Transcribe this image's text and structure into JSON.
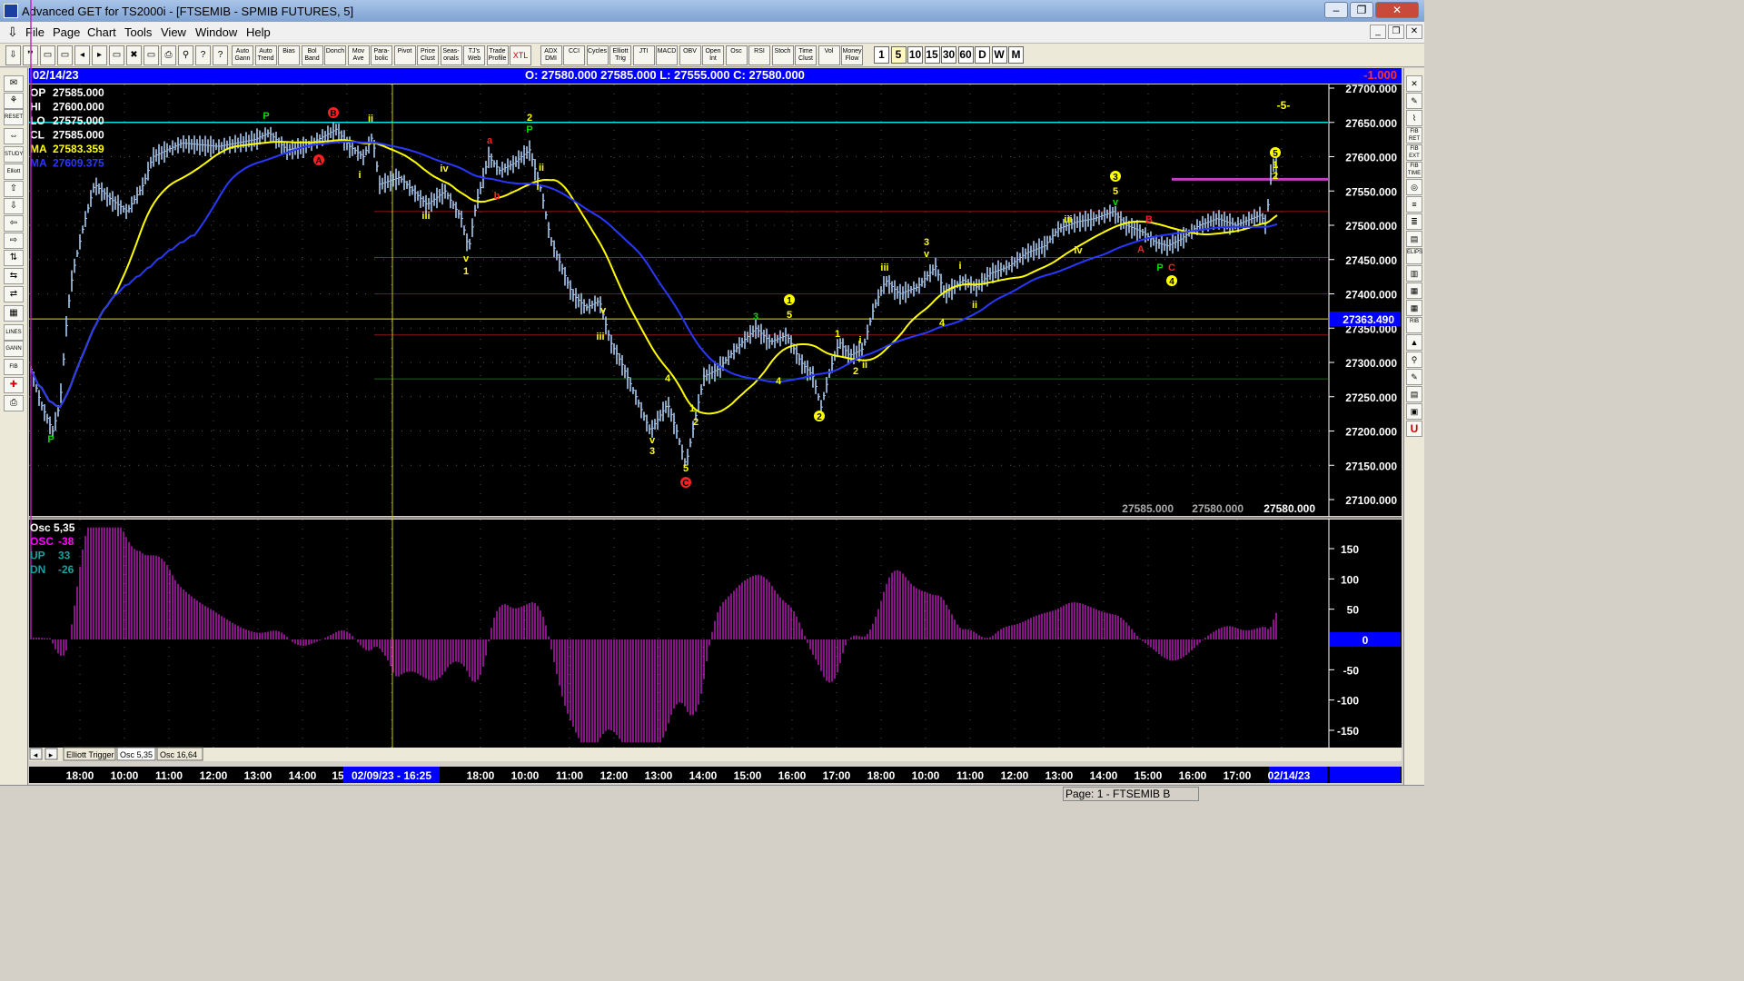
{
  "window": {
    "title": "Advanced GET for TS2000i - [FTSEMIB - SPMIB FUTURES, 5]",
    "controls": [
      "‒",
      "❐",
      "✕"
    ]
  },
  "menu": [
    "File",
    "Page",
    "Chart",
    "Tools",
    "View",
    "Window",
    "Help"
  ],
  "toolbar": {
    "study_buttons": [
      "Auto Gann",
      "Auto Trend",
      "Bias",
      "Bol Band",
      "Donch",
      "Mov Ave",
      "Para-bolic",
      "Pivot",
      "Price Clust",
      "Seas-onals",
      "TJ's Web",
      "Trade Profile",
      "XTL",
      "ADX DMI",
      "CCI",
      "Cycles",
      "Elliott Trig",
      "JTI",
      "MACD",
      "OBV",
      "Open Int",
      "Osc",
      "RSI",
      "Stoch",
      "Time Clust",
      "Vol",
      "Money Flow"
    ],
    "timeframes": [
      "1",
      "5",
      "10",
      "15",
      "30",
      "60",
      "D",
      "W",
      "M"
    ],
    "selected_timeframe": "5"
  },
  "left_tools": [
    "RESET",
    "STUDY",
    "Elliott",
    "LINES",
    "GANN",
    "FIB"
  ],
  "right_tools": [
    "FIB RET",
    "FIB EXT",
    "FIB TIME",
    "ELIPS",
    "RIB"
  ],
  "header": {
    "date": "02/14/23",
    "ohlc_text": "O: 27580.000     27585.000   L: 27555.000   C: 27580.000",
    "change": "-1.000"
  },
  "price_panel": {
    "info": [
      {
        "label": "OP",
        "value": "27585.000",
        "color": "#ffffff"
      },
      {
        "label": "HI",
        "value": "27600.000",
        "color": "#ffffff"
      },
      {
        "label": "LO",
        "value": "27575.000",
        "color": "#ffffff"
      },
      {
        "label": "CL",
        "value": "27585.000",
        "color": "#ffffff"
      },
      {
        "label": "MA",
        "value": "27583.359",
        "color": "#ffff00"
      },
      {
        "label": "MA",
        "value": "27609.375",
        "color": "#2a38ff"
      }
    ],
    "y_ticks": [
      "27700.000",
      "27650.000",
      "27600.000",
      "27550.000",
      "27500.000",
      "27450.000",
      "27400.000",
      "27350.000",
      "27300.000",
      "27250.000",
      "27200.000",
      "27150.000",
      "27100.000"
    ],
    "current_price_label": "27363.490",
    "bottom_values": [
      "27585.000",
      "27580.000",
      "27580.000"
    ],
    "wave_count_label": "-5-"
  },
  "osc_panel": {
    "title": "Osc 5,35",
    "rows": [
      {
        "label": "OSC",
        "value": "-38",
        "color": "#ff00ff"
      },
      {
        "label": "UP",
        "value": "33",
        "color": "#1aa0a0"
      },
      {
        "label": "DN",
        "value": "-26",
        "color": "#1aa0a0"
      }
    ],
    "y_ticks": [
      "150",
      "100",
      "50",
      "0",
      "-50",
      "-100",
      "-150"
    ],
    "zero_label": "0"
  },
  "tabs": [
    "Elliott Trigger",
    "Osc 5,35",
    "Osc 16,64"
  ],
  "time_axis": [
    "18:00",
    "10:00",
    "11:00",
    "12:00",
    "13:00",
    "14:00",
    "15",
    "18:00",
    "10:00",
    "11:00",
    "12:00",
    "13:00",
    "14:00",
    "15:00",
    "16:00",
    "17:00",
    "18:00",
    "10:00",
    "11:00",
    "12:00",
    "13:00",
    "14:00",
    "15:00",
    "16:00",
    "17:00",
    "02/14/23"
  ],
  "cursor_date": "02/09/23 - 16:25",
  "status": "Page: 1 - FTSEMIB B",
  "wave_labels": [
    {
      "t": "P",
      "color": "#00e000"
    },
    {
      "t": "P",
      "color": "#00e000"
    },
    {
      "t": "B",
      "color": "#ff2020"
    },
    {
      "t": "A",
      "color": "#ff2020"
    },
    {
      "t": "ii",
      "color": "#ffff00"
    },
    {
      "t": "i",
      "color": "#ffff00"
    },
    {
      "t": "iv",
      "color": "#ffff00"
    },
    {
      "t": "iii",
      "color": "#ffff00"
    },
    {
      "t": "v",
      "color": "#ffff00"
    },
    {
      "t": "1",
      "color": "#ffff00"
    },
    {
      "t": "a",
      "color": "#ff2020"
    },
    {
      "t": "b",
      "color": "#ff2020"
    },
    {
      "t": "2",
      "color": "#ffff00"
    },
    {
      "t": "P",
      "color": "#00e000"
    },
    {
      "t": "ii",
      "color": "#ffff00"
    },
    {
      "t": "i",
      "color": "#ffff00"
    },
    {
      "t": "v",
      "color": "#ffff00"
    },
    {
      "t": "iii",
      "color": "#ffff00"
    },
    {
      "t": "4",
      "color": "#ffff00"
    },
    {
      "t": "v",
      "color": "#ffff00"
    },
    {
      "t": "3",
      "color": "#ffff00"
    },
    {
      "t": "1",
      "color": "#ffff00"
    },
    {
      "t": "2",
      "color": "#ffff00"
    },
    {
      "t": "5",
      "color": "#ffff00"
    },
    {
      "t": "C",
      "color": "#ff2020"
    },
    {
      "t": "3",
      "color": "#00e000"
    },
    {
      "t": "4",
      "color": "#ffff00"
    },
    {
      "t": "1",
      "color": "#ffff00"
    },
    {
      "t": "5",
      "color": "#ffff00"
    },
    {
      "t": "2",
      "color": "#ffff00"
    },
    {
      "t": "1",
      "color": "#ffff00"
    },
    {
      "t": "2",
      "color": "#ffff00"
    },
    {
      "t": "i",
      "color": "#ffff00"
    },
    {
      "t": "ii",
      "color": "#ffff00"
    },
    {
      "t": "iii",
      "color": "#ffff00"
    },
    {
      "t": "3",
      "color": "#ffff00"
    },
    {
      "t": "v",
      "color": "#ffff00"
    },
    {
      "t": "4",
      "color": "#ffff00"
    },
    {
      "t": "i",
      "color": "#ffff00"
    },
    {
      "t": "ii",
      "color": "#ffff00"
    },
    {
      "t": "iii",
      "color": "#ffff00"
    },
    {
      "t": "iv",
      "color": "#ffff00"
    },
    {
      "t": "3",
      "color": "#ffff00"
    },
    {
      "t": "5",
      "color": "#ffff00"
    },
    {
      "t": "v",
      "color": "#00e000"
    },
    {
      "t": "B",
      "color": "#ff2020"
    },
    {
      "t": "A",
      "color": "#ff2020"
    },
    {
      "t": "P",
      "color": "#00e000"
    },
    {
      "t": "C",
      "color": "#ff2020"
    },
    {
      "t": "4",
      "color": "#ffff00"
    },
    {
      "t": "5",
      "color": "#ffff00"
    },
    {
      "t": "1",
      "color": "#ffff00"
    },
    {
      "t": "2",
      "color": "#ffff00"
    }
  ],
  "colors": {
    "background": "#000000",
    "header_bar": "#0000ff",
    "price_bars": "#a8c8f0",
    "ma_fast": "#ffff00",
    "ma_slow": "#2a38ff",
    "oscillator": "#c020c0",
    "osc_band": "#1aa0a0",
    "hline_cyan": "#00e0e0",
    "hline_yellow": "#e0e000"
  }
}
